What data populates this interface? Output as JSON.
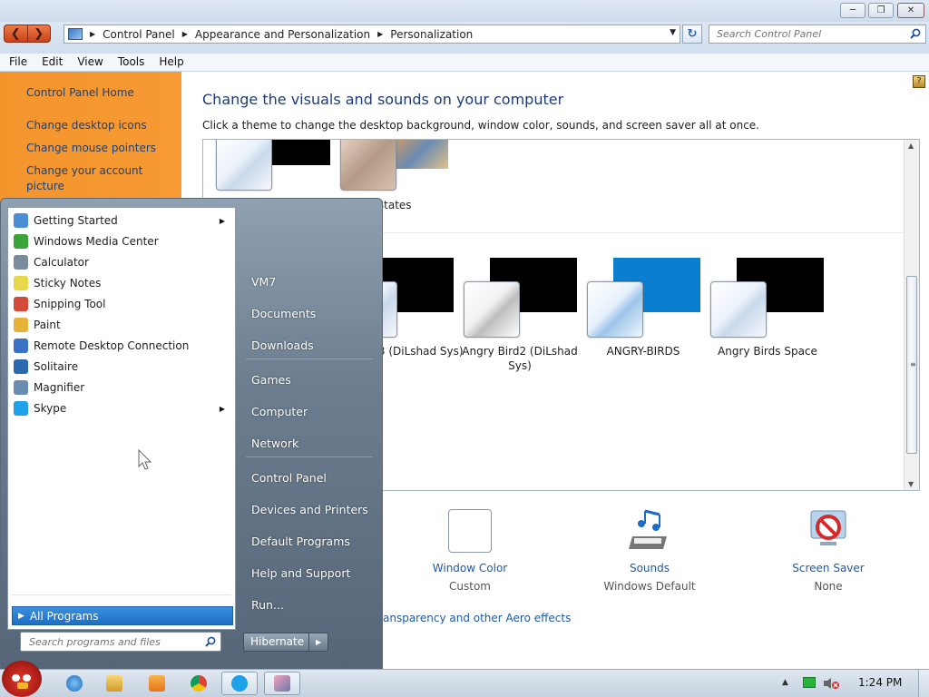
{
  "address": {
    "crumbs": [
      "Control Panel",
      "Appearance and Personalization",
      "Personalization"
    ],
    "search_placeholder": "Search Control Panel"
  },
  "menu": [
    "File",
    "Edit",
    "View",
    "Tools",
    "Help"
  ],
  "left_pane": {
    "links": [
      "Control Panel Home",
      "Change desktop icons",
      "Change mouse pointers",
      "Change your account picture"
    ]
  },
  "content": {
    "title": "Change the visuals and sounds on your computer",
    "subtitle": "Click a theme to change the desktop background, window color, sounds, and screen saver all at once.",
    "themes_top": [
      {
        "label": ""
      },
      {
        "label": "ted States"
      }
    ],
    "themes_row": [
      {
        "label": "ird 3 (DiLshad Sys)"
      },
      {
        "label": "Angry Bird2 (DiLshad Sys)"
      },
      {
        "label": "ANGRY-BIRDS"
      },
      {
        "label": "Angry Birds Space"
      }
    ],
    "bottom": {
      "window_color": {
        "label": "Window Color",
        "value": "Custom"
      },
      "sounds": {
        "label": "Sounds",
        "value": "Windows Default"
      },
      "screen_saver": {
        "label": "Screen Saver",
        "value": "None"
      }
    },
    "aero_link": "ansparency and other Aero effects"
  },
  "start_menu": {
    "programs": [
      {
        "label": "Getting Started",
        "submenu": true,
        "color": "#4a8fd6"
      },
      {
        "label": "Windows Media Center",
        "submenu": false,
        "color": "#3aa43a"
      },
      {
        "label": "Calculator",
        "submenu": false,
        "color": "#7b8b9e"
      },
      {
        "label": "Sticky Notes",
        "submenu": false,
        "color": "#e6d84a"
      },
      {
        "label": "Snipping Tool",
        "submenu": false,
        "color": "#d44a3a"
      },
      {
        "label": "Paint",
        "submenu": false,
        "color": "#e8b23a"
      },
      {
        "label": "Remote Desktop Connection",
        "submenu": false,
        "color": "#3a72c8"
      },
      {
        "label": "Solitaire",
        "submenu": false,
        "color": "#2c6ab0"
      },
      {
        "label": "Magnifier",
        "submenu": false,
        "color": "#6a8cb2"
      },
      {
        "label": "Skype",
        "submenu": true,
        "color": "#1da1e8"
      }
    ],
    "all_programs": "All Programs",
    "search_placeholder": "Search programs and files",
    "right": [
      "VM7",
      "Documents",
      "Downloads",
      "Games",
      "Computer",
      "Network",
      "Control Panel",
      "Devices and Printers",
      "Default Programs",
      "Help and Support",
      "Run..."
    ],
    "hibernate": "Hibernate"
  },
  "taskbar": {
    "clock": "1:24 PM"
  }
}
